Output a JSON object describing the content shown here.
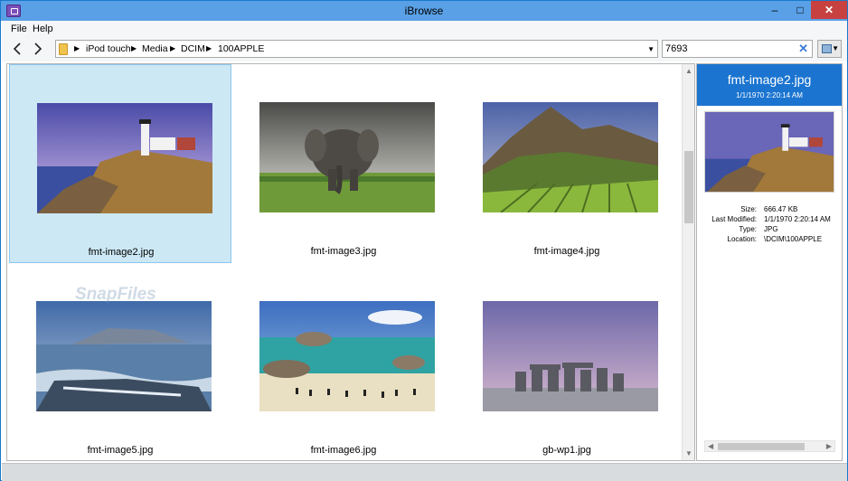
{
  "window": {
    "title": "iBrowse"
  },
  "menu": {
    "file": "File",
    "help": "Help"
  },
  "breadcrumb": [
    "iPod touch",
    "Media",
    "DCIM",
    "100APPLE"
  ],
  "search": {
    "value": "7693"
  },
  "thumbnails": [
    {
      "name": "fmt-image2.jpg",
      "scene": "lighthouse",
      "selected": true
    },
    {
      "name": "fmt-image3.jpg",
      "scene": "elephant",
      "selected": false
    },
    {
      "name": "fmt-image4.jpg",
      "scene": "vineyard",
      "selected": false
    },
    {
      "name": "fmt-image5.jpg",
      "scene": "waterfall",
      "selected": false
    },
    {
      "name": "fmt-image6.jpg",
      "scene": "beach",
      "selected": false
    },
    {
      "name": "gb-wp1.jpg",
      "scene": "stonehenge",
      "selected": false
    }
  ],
  "details": {
    "filename": "fmt-image2.jpg",
    "date": "1/1/1970 2:20:14 AM",
    "rows": [
      {
        "key": "Size:",
        "value": "666.47 KB"
      },
      {
        "key": "Last Modified:",
        "value": "1/1/1970 2:20:14 AM"
      },
      {
        "key": "Type:",
        "value": "JPG"
      },
      {
        "key": "Location:",
        "value": "\\DCIM\\100APPLE"
      }
    ]
  },
  "watermark": "SnapFiles",
  "colors": {
    "accent": "#1b74d0",
    "selection": "#cce8f5",
    "titlebar": "#5aa0e6",
    "close": "#c74141"
  }
}
